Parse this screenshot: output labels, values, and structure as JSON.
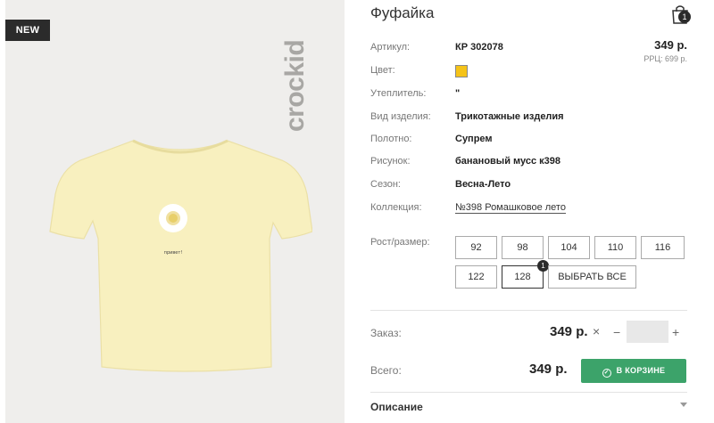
{
  "photo": {
    "badge": "NEW",
    "brand_logo": "crockid",
    "print_text": "привет!"
  },
  "product": {
    "title": "Фуфайка",
    "cart_count": "1",
    "price": "349 р.",
    "rrp": "РРЦ: 699 р.",
    "swatch_color": "#f5c318",
    "attributes": [
      {
        "label": "Артикул:",
        "value": "КР 302078"
      },
      {
        "label": "Цвет:",
        "value": ""
      },
      {
        "label": "Утеплитель:",
        "value": "\""
      },
      {
        "label": "Вид изделия:",
        "value": "Трикотажные изделия"
      },
      {
        "label": "Полотно:",
        "value": "Супрем"
      },
      {
        "label": "Рисунок:",
        "value": "банановый мусс к398"
      },
      {
        "label": "Сезон:",
        "value": "Весна-Лето"
      },
      {
        "label": "Коллекция:",
        "value": "№398 Ромашковое лето"
      }
    ]
  },
  "sizes": {
    "label": "Рост/размер:",
    "options": [
      "92",
      "98",
      "104",
      "110",
      "116",
      "122",
      "128"
    ],
    "selected": "128",
    "selected_count": "1",
    "select_all": "ВЫБРАТЬ ВСЕ"
  },
  "order": {
    "label": "Заказ:",
    "price": "349 р.",
    "multiply": "×",
    "minus": "−",
    "plus": "+",
    "quantity": ""
  },
  "total": {
    "label": "Всего:",
    "value": "349 р.",
    "cart_button": "В КОРЗИНЕ",
    "button_color": "#3ca36a"
  },
  "description": {
    "label": "Описание"
  }
}
